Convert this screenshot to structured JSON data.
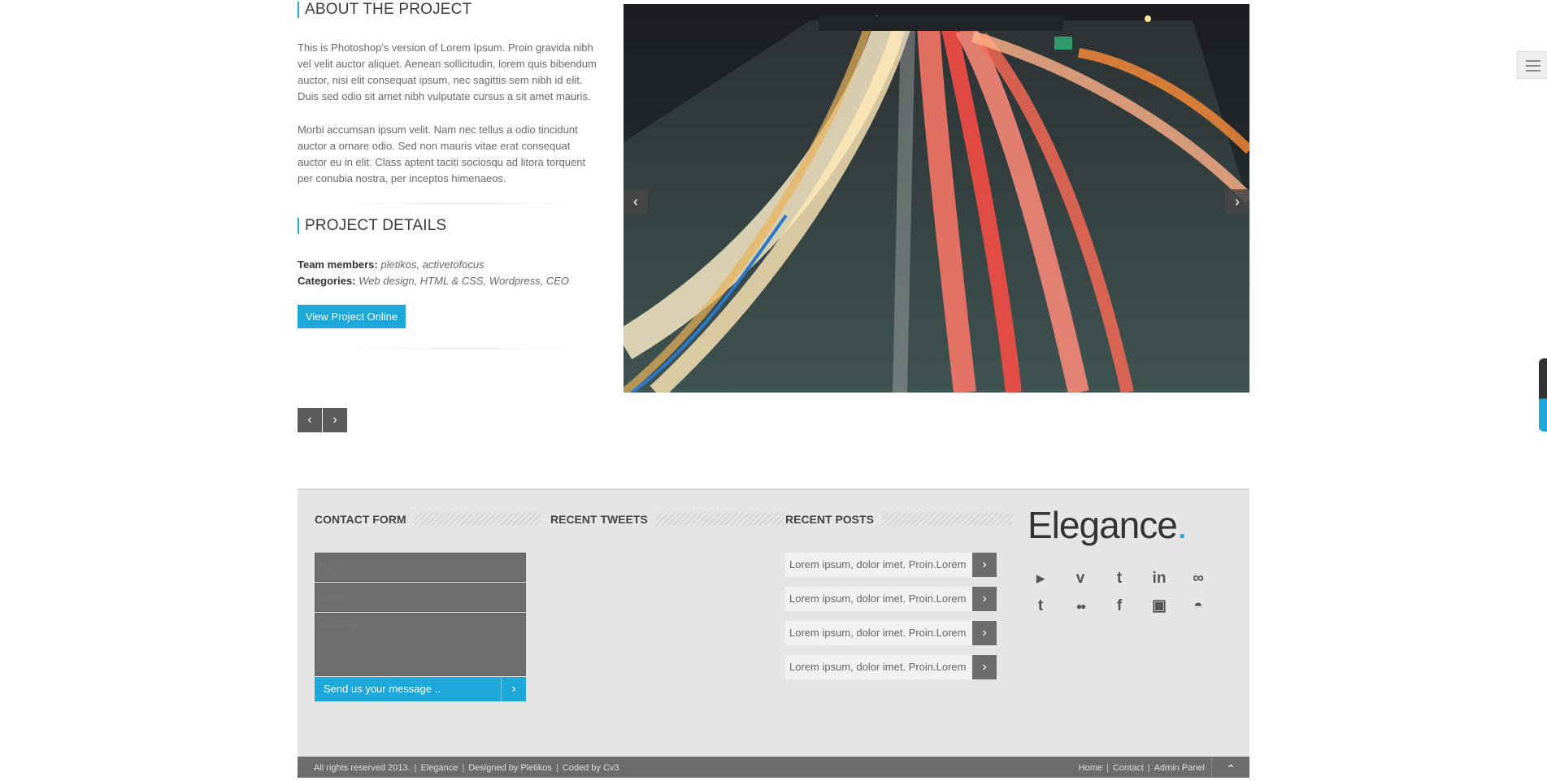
{
  "about": {
    "title": "ABOUT THE PROJECT",
    "paragraph1": "This is Photoshop's version of Lorem Ipsum. Proin gravida nibh vel velit auctor aliquet. Aenean sollicitudin, lorem quis bibendum auctor, nisi elit consequat ipsum, nec sagittis sem nibh id elit. Duis sed odio sit amet nibh vulputate cursus a sit amet mauris.",
    "paragraph2": "Morbi accumsan ipsum velit. Nam nec tellus a odio tincidunt auctor a ornare odio. Sed non mauris vitae erat consequat auctor eu in elit. Class aptent taciti sociosqu ad litora torquent per conubia nostra, per inceptos himenaeos."
  },
  "details": {
    "title": "PROJECT DETAILS",
    "team_label": "Team members:",
    "team_value": "pletikos, activetofocus",
    "categories_label": "Categories:",
    "categories_value": "Web design, HTML & CSS, Wordpress, CEO",
    "button_label": "View Project Online"
  },
  "slider": {
    "prev_icon": "‹",
    "next_icon": "›"
  },
  "pager": {
    "prev_icon": "‹",
    "next_icon": "›"
  },
  "footer": {
    "contact": {
      "title": "CONTACT FORM",
      "name_placeholder": "Name ..",
      "email_placeholder": "Email ..",
      "message_placeholder": "Message ..",
      "send_label": "Send us your message ..",
      "send_icon": "›"
    },
    "tweets": {
      "title": "RECENT TWEETS"
    },
    "posts": {
      "title": "RECENT POSTS",
      "items": [
        "Lorem ipsum, dolor imet. Proin.Lorem",
        "Lorem ipsum, dolor imet. Proin.Lorem",
        "Lorem ipsum, dolor imet. Proin.Lorem",
        "Lorem ipsum, dolor imet. Proin.Lorem"
      ],
      "arrow_icon": "›"
    },
    "brand": {
      "name": "Elegance",
      "dot": "."
    },
    "social_icons": [
      "youtube-icon",
      "vimeo-icon",
      "twitter-icon",
      "linkedin-icon",
      "lastfm-icon",
      "tumblr-icon",
      "flickr-icon",
      "facebook-icon",
      "delicious-icon",
      "stumbleupon-icon"
    ],
    "social_glyphs": {
      "youtube": "▶",
      "vimeo": "v",
      "twitter": "t",
      "linkedin": "in",
      "lastfm": "∞",
      "tumblr": "t",
      "flickr": "●●",
      "facebook": "f",
      "delicious": "▣",
      "stumbleupon": "◓"
    }
  },
  "bottom_bar": {
    "copyright": "All rights reserved 2013.",
    "brand": "Elegance",
    "designed": "Designed by Pletikos",
    "coded": "Coded by Cv3",
    "links": [
      "Home",
      "Contact",
      "Admin Panel"
    ],
    "to_top_icon": "⌃"
  },
  "colors": {
    "accent": "#1ea7d9",
    "footer_bg": "#e5e5e5",
    "dark_gray": "#6c6c6c"
  }
}
